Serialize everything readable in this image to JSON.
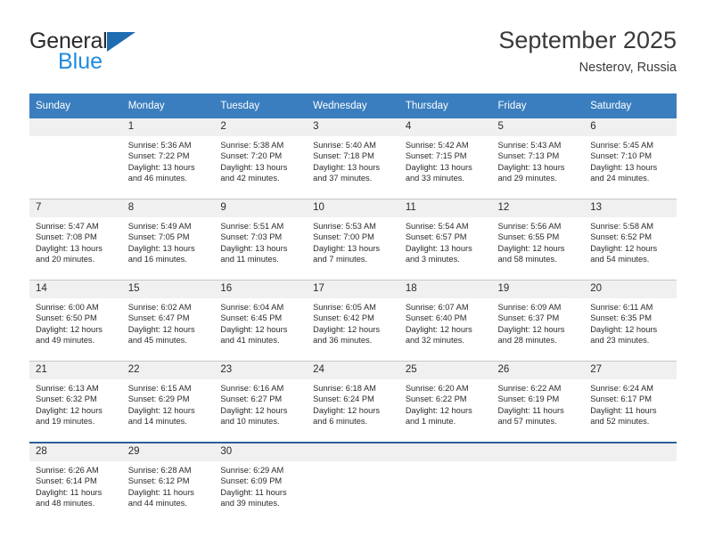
{
  "branding": {
    "logo_primary": "General",
    "logo_secondary": "Blue",
    "logo_icon": "blue-triangle-icon"
  },
  "header": {
    "title": "September 2025",
    "subtitle": "Nesterov, Russia"
  },
  "colors": {
    "header_blue": "#3a7ebf",
    "logo_blue": "#1f8ae0",
    "logo_triangle": "#1f6cb0",
    "daynum_band": "#f0f0f0",
    "row_divider": "#c8c8c8",
    "last_row_divider": "#2c5f96"
  },
  "weekdays": [
    "Sunday",
    "Monday",
    "Tuesday",
    "Wednesday",
    "Thursday",
    "Friday",
    "Saturday"
  ],
  "labels": {
    "sunrise": "Sunrise:",
    "sunset": "Sunset:",
    "daylight": "Daylight:"
  },
  "weeks": [
    [
      {
        "day": "",
        "empty": true
      },
      {
        "day": "1",
        "sunrise": "Sunrise: 5:36 AM",
        "sunset": "Sunset: 7:22 PM",
        "daylight_1": "Daylight: 13 hours",
        "daylight_2": "and 46 minutes."
      },
      {
        "day": "2",
        "sunrise": "Sunrise: 5:38 AM",
        "sunset": "Sunset: 7:20 PM",
        "daylight_1": "Daylight: 13 hours",
        "daylight_2": "and 42 minutes."
      },
      {
        "day": "3",
        "sunrise": "Sunrise: 5:40 AM",
        "sunset": "Sunset: 7:18 PM",
        "daylight_1": "Daylight: 13 hours",
        "daylight_2": "and 37 minutes."
      },
      {
        "day": "4",
        "sunrise": "Sunrise: 5:42 AM",
        "sunset": "Sunset: 7:15 PM",
        "daylight_1": "Daylight: 13 hours",
        "daylight_2": "and 33 minutes."
      },
      {
        "day": "5",
        "sunrise": "Sunrise: 5:43 AM",
        "sunset": "Sunset: 7:13 PM",
        "daylight_1": "Daylight: 13 hours",
        "daylight_2": "and 29 minutes."
      },
      {
        "day": "6",
        "sunrise": "Sunrise: 5:45 AM",
        "sunset": "Sunset: 7:10 PM",
        "daylight_1": "Daylight: 13 hours",
        "daylight_2": "and 24 minutes."
      }
    ],
    [
      {
        "day": "7",
        "sunrise": "Sunrise: 5:47 AM",
        "sunset": "Sunset: 7:08 PM",
        "daylight_1": "Daylight: 13 hours",
        "daylight_2": "and 20 minutes."
      },
      {
        "day": "8",
        "sunrise": "Sunrise: 5:49 AM",
        "sunset": "Sunset: 7:05 PM",
        "daylight_1": "Daylight: 13 hours",
        "daylight_2": "and 16 minutes."
      },
      {
        "day": "9",
        "sunrise": "Sunrise: 5:51 AM",
        "sunset": "Sunset: 7:03 PM",
        "daylight_1": "Daylight: 13 hours",
        "daylight_2": "and 11 minutes."
      },
      {
        "day": "10",
        "sunrise": "Sunrise: 5:53 AM",
        "sunset": "Sunset: 7:00 PM",
        "daylight_1": "Daylight: 13 hours",
        "daylight_2": "and 7 minutes."
      },
      {
        "day": "11",
        "sunrise": "Sunrise: 5:54 AM",
        "sunset": "Sunset: 6:57 PM",
        "daylight_1": "Daylight: 13 hours",
        "daylight_2": "and 3 minutes."
      },
      {
        "day": "12",
        "sunrise": "Sunrise: 5:56 AM",
        "sunset": "Sunset: 6:55 PM",
        "daylight_1": "Daylight: 12 hours",
        "daylight_2": "and 58 minutes."
      },
      {
        "day": "13",
        "sunrise": "Sunrise: 5:58 AM",
        "sunset": "Sunset: 6:52 PM",
        "daylight_1": "Daylight: 12 hours",
        "daylight_2": "and 54 minutes."
      }
    ],
    [
      {
        "day": "14",
        "sunrise": "Sunrise: 6:00 AM",
        "sunset": "Sunset: 6:50 PM",
        "daylight_1": "Daylight: 12 hours",
        "daylight_2": "and 49 minutes."
      },
      {
        "day": "15",
        "sunrise": "Sunrise: 6:02 AM",
        "sunset": "Sunset: 6:47 PM",
        "daylight_1": "Daylight: 12 hours",
        "daylight_2": "and 45 minutes."
      },
      {
        "day": "16",
        "sunrise": "Sunrise: 6:04 AM",
        "sunset": "Sunset: 6:45 PM",
        "daylight_1": "Daylight: 12 hours",
        "daylight_2": "and 41 minutes."
      },
      {
        "day": "17",
        "sunrise": "Sunrise: 6:05 AM",
        "sunset": "Sunset: 6:42 PM",
        "daylight_1": "Daylight: 12 hours",
        "daylight_2": "and 36 minutes."
      },
      {
        "day": "18",
        "sunrise": "Sunrise: 6:07 AM",
        "sunset": "Sunset: 6:40 PM",
        "daylight_1": "Daylight: 12 hours",
        "daylight_2": "and 32 minutes."
      },
      {
        "day": "19",
        "sunrise": "Sunrise: 6:09 AM",
        "sunset": "Sunset: 6:37 PM",
        "daylight_1": "Daylight: 12 hours",
        "daylight_2": "and 28 minutes."
      },
      {
        "day": "20",
        "sunrise": "Sunrise: 6:11 AM",
        "sunset": "Sunset: 6:35 PM",
        "daylight_1": "Daylight: 12 hours",
        "daylight_2": "and 23 minutes."
      }
    ],
    [
      {
        "day": "21",
        "sunrise": "Sunrise: 6:13 AM",
        "sunset": "Sunset: 6:32 PM",
        "daylight_1": "Daylight: 12 hours",
        "daylight_2": "and 19 minutes."
      },
      {
        "day": "22",
        "sunrise": "Sunrise: 6:15 AM",
        "sunset": "Sunset: 6:29 PM",
        "daylight_1": "Daylight: 12 hours",
        "daylight_2": "and 14 minutes."
      },
      {
        "day": "23",
        "sunrise": "Sunrise: 6:16 AM",
        "sunset": "Sunset: 6:27 PM",
        "daylight_1": "Daylight: 12 hours",
        "daylight_2": "and 10 minutes."
      },
      {
        "day": "24",
        "sunrise": "Sunrise: 6:18 AM",
        "sunset": "Sunset: 6:24 PM",
        "daylight_1": "Daylight: 12 hours",
        "daylight_2": "and 6 minutes."
      },
      {
        "day": "25",
        "sunrise": "Sunrise: 6:20 AM",
        "sunset": "Sunset: 6:22 PM",
        "daylight_1": "Daylight: 12 hours",
        "daylight_2": "and 1 minute."
      },
      {
        "day": "26",
        "sunrise": "Sunrise: 6:22 AM",
        "sunset": "Sunset: 6:19 PM",
        "daylight_1": "Daylight: 11 hours",
        "daylight_2": "and 57 minutes."
      },
      {
        "day": "27",
        "sunrise": "Sunrise: 6:24 AM",
        "sunset": "Sunset: 6:17 PM",
        "daylight_1": "Daylight: 11 hours",
        "daylight_2": "and 52 minutes."
      }
    ],
    [
      {
        "day": "28",
        "sunrise": "Sunrise: 6:26 AM",
        "sunset": "Sunset: 6:14 PM",
        "daylight_1": "Daylight: 11 hours",
        "daylight_2": "and 48 minutes."
      },
      {
        "day": "29",
        "sunrise": "Sunrise: 6:28 AM",
        "sunset": "Sunset: 6:12 PM",
        "daylight_1": "Daylight: 11 hours",
        "daylight_2": "and 44 minutes."
      },
      {
        "day": "30",
        "sunrise": "Sunrise: 6:29 AM",
        "sunset": "Sunset: 6:09 PM",
        "daylight_1": "Daylight: 11 hours",
        "daylight_2": "and 39 minutes."
      },
      {
        "day": "",
        "empty": true
      },
      {
        "day": "",
        "empty": true
      },
      {
        "day": "",
        "empty": true
      },
      {
        "day": "",
        "empty": true
      }
    ]
  ]
}
